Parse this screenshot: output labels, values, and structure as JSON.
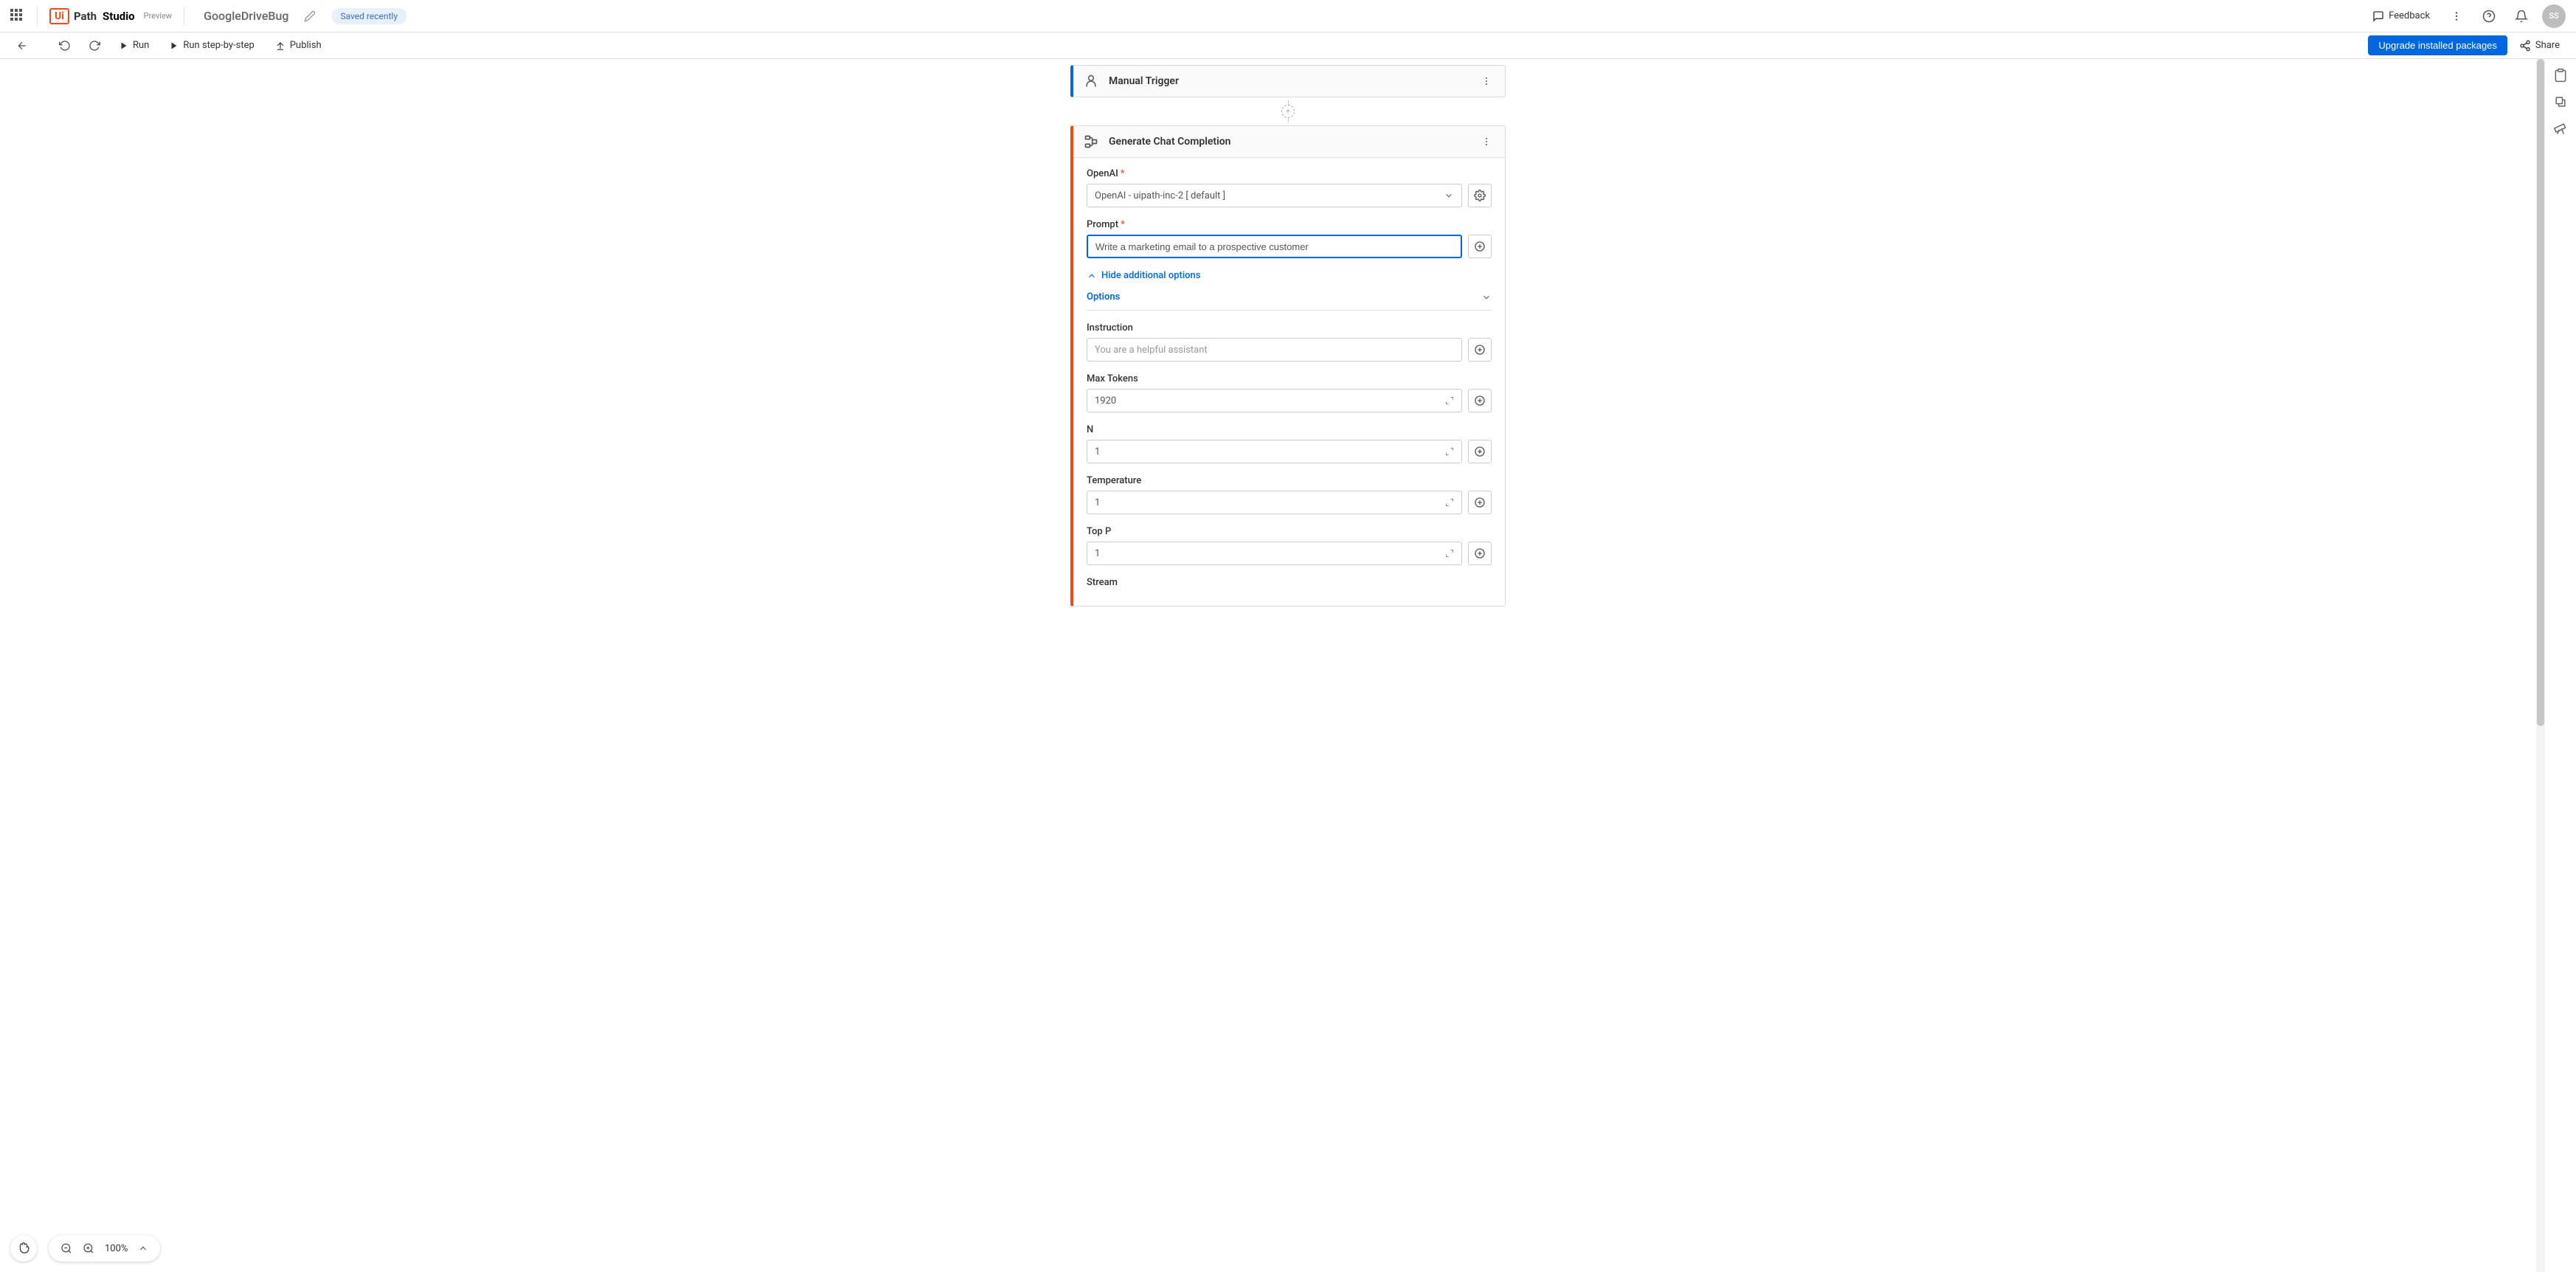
{
  "header": {
    "logo_prefix": "Ui",
    "logo_suffix": "Path",
    "studio": "Studio",
    "preview": "Preview",
    "project_name": "GoogleDriveBug",
    "saved_status": "Saved recently",
    "feedback": "Feedback",
    "avatar_initials": "SS"
  },
  "toolbar": {
    "run": "Run",
    "run_step": "Run step-by-step",
    "publish": "Publish",
    "upgrade": "Upgrade installed packages",
    "share": "Share"
  },
  "canvas": {
    "manual_trigger": {
      "title": "Manual Trigger"
    },
    "activity": {
      "title": "Generate Chat Completion",
      "fields": {
        "openai": {
          "label": "OpenAI",
          "value": "OpenAI - uipath-inc-2 [ default ]"
        },
        "prompt": {
          "label": "Prompt",
          "value": "Write a marketing email to a prospective customer"
        },
        "hide_options": "Hide additional options",
        "options_section": "Options",
        "instruction": {
          "label": "Instruction",
          "placeholder": "You are a helpful assistant"
        },
        "max_tokens": {
          "label": "Max Tokens",
          "value": "1920"
        },
        "n": {
          "label": "N",
          "value": "1"
        },
        "temperature": {
          "label": "Temperature",
          "value": "1"
        },
        "top_p": {
          "label": "Top P",
          "value": "1"
        },
        "stream": {
          "label": "Stream"
        }
      }
    }
  },
  "zoom": {
    "percent": "100%"
  }
}
